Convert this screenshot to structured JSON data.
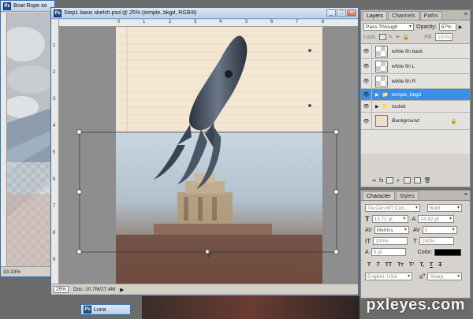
{
  "background_window": {
    "title": "Boat Rope so",
    "zoom": "33.33%"
  },
  "main_window": {
    "title": "Step1 basic sketch.psd @ 25% (temple, bkgd, RGB/8)",
    "zoom": "25%",
    "doc_info": "Doc: 10.7M/27.4M",
    "ruler_h": [
      "0",
      "1",
      "2",
      "3",
      "4",
      "5",
      "6",
      "7",
      "8"
    ],
    "ruler_v": [
      "1",
      "2",
      "3",
      "4",
      "5",
      "6",
      "7",
      "8",
      "9",
      "1"
    ]
  },
  "taskbar_item": {
    "title": "Luna"
  },
  "layers_panel": {
    "tabs": [
      "Layers",
      "Channels",
      "Paths"
    ],
    "blend_mode": "Pass Through",
    "opacity_label": "Opacity:",
    "opacity_value": "57%",
    "lock_label": "Lock:",
    "fill_label": "Fill:",
    "fill_value": "100%",
    "layers": [
      {
        "name": "white fin back",
        "type": "layer",
        "selected": false
      },
      {
        "name": "white fin L",
        "type": "layer",
        "selected": false
      },
      {
        "name": "white fin R",
        "type": "layer",
        "selected": false
      },
      {
        "name": "temple, bkgd",
        "type": "group",
        "selected": true
      },
      {
        "name": "rocket",
        "type": "group",
        "selected": false
      },
      {
        "name": "Background",
        "type": "background",
        "selected": false
      }
    ]
  },
  "character_panel": {
    "tabs": [
      "Character",
      "Styles"
    ],
    "font_family": "Tw Cen MT Con...",
    "font_style": "Bold",
    "font_size": "13.72 pt",
    "leading": "14.82 pt",
    "kerning": "Metrics",
    "tracking": "0",
    "vertical_scale": "100%",
    "horizontal_scale": "100%",
    "baseline_shift": "0 pt",
    "color_label": "Color:",
    "color_value": "#000000",
    "language": "English: USA",
    "aa_label": "a",
    "antialias": "Sharp",
    "type_styles": [
      "T",
      "T",
      "TT",
      "Tт",
      "T¹",
      "T,",
      "T",
      "T"
    ]
  },
  "watermark": {
    "text": "pxleyes.com"
  }
}
